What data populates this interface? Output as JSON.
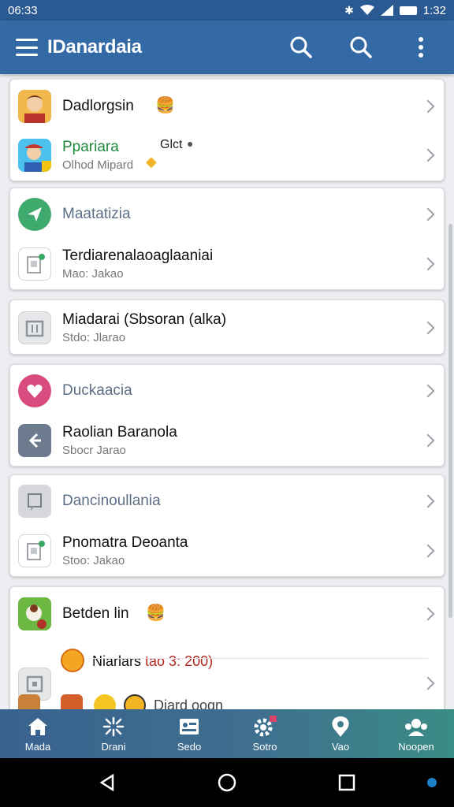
{
  "status_bar": {
    "time": "06:33",
    "clock": "1:32"
  },
  "app_bar": {
    "title": "IDanardaia"
  },
  "cards": [
    {
      "rows": [
        {
          "title": "Dadlorgsin",
          "subtitle": "",
          "badge": ""
        },
        {
          "title": "Ppariara",
          "subtitle": "Olhod Mipard",
          "badge": "Glct"
        }
      ]
    },
    {
      "rows": [
        {
          "title": "Maatatizia",
          "subtitle": ""
        },
        {
          "title": "Terdiarenalaoaglaaniai",
          "subtitle": "Mao: Jakao"
        }
      ]
    },
    {
      "rows": [
        {
          "title": "Miadarai (Sbsoran (alka)",
          "subtitle": "Stdo: Jlarao"
        }
      ]
    },
    {
      "rows": [
        {
          "title": "Duckaacia",
          "subtitle": ""
        },
        {
          "title": "Raolian Baranola",
          "subtitle": "Sbocr Jarao"
        }
      ]
    },
    {
      "rows": [
        {
          "title": "Dancinoullania",
          "subtitle": ""
        },
        {
          "title": "Pnomatra Deoanta",
          "subtitle": "Stoo: Jakao"
        }
      ]
    },
    {
      "rows": [
        {
          "title": "Betden lin",
          "subtitle": ""
        },
        {
          "title": "Niarlars",
          "highlight": "tao 3: 200)"
        },
        {
          "title": "Diard oogn"
        }
      ]
    }
  ],
  "bottom_nav": [
    {
      "label": "Mada",
      "icon": "home-icon"
    },
    {
      "label": "Drani",
      "icon": "sparkle-icon"
    },
    {
      "label": "Sedo",
      "icon": "id-card-icon"
    },
    {
      "label": "Sotro",
      "icon": "settings-icon"
    },
    {
      "label": "Vao",
      "icon": "location-icon"
    },
    {
      "label": "Noopen",
      "icon": "people-icon"
    }
  ],
  "colors": {
    "status_bar": "#2a5a91",
    "app_bar": "#336aa6",
    "green_title": "#1f8a3c",
    "highlight": "#b3261e"
  }
}
